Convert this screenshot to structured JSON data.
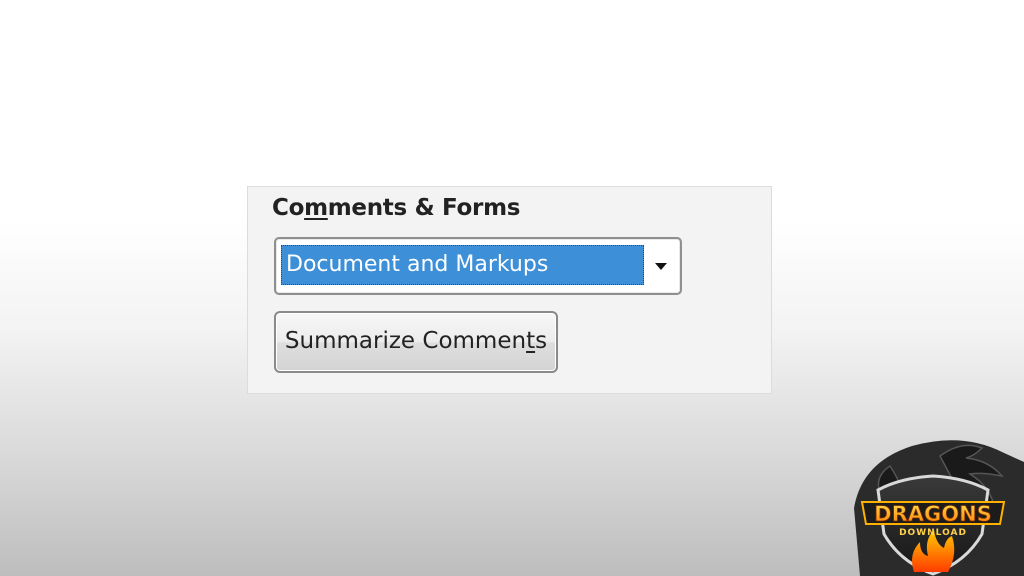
{
  "section": {
    "title_before": "Co",
    "title_accel": "m",
    "title_after": "ments & Forms"
  },
  "dropdown": {
    "selected": "Document and Markups"
  },
  "summarize_button": {
    "label_before": "Summarize Commen",
    "label_accel": "t",
    "label_after": "s"
  },
  "logo": {
    "text_main": "DRAGONS",
    "text_sub": "DOWNLOAD"
  },
  "colors": {
    "selection": "#3d8fd8",
    "panel": "#f3f3f3",
    "logo_orange": "#ff8a00",
    "logo_dark": "#2a2a2a"
  }
}
